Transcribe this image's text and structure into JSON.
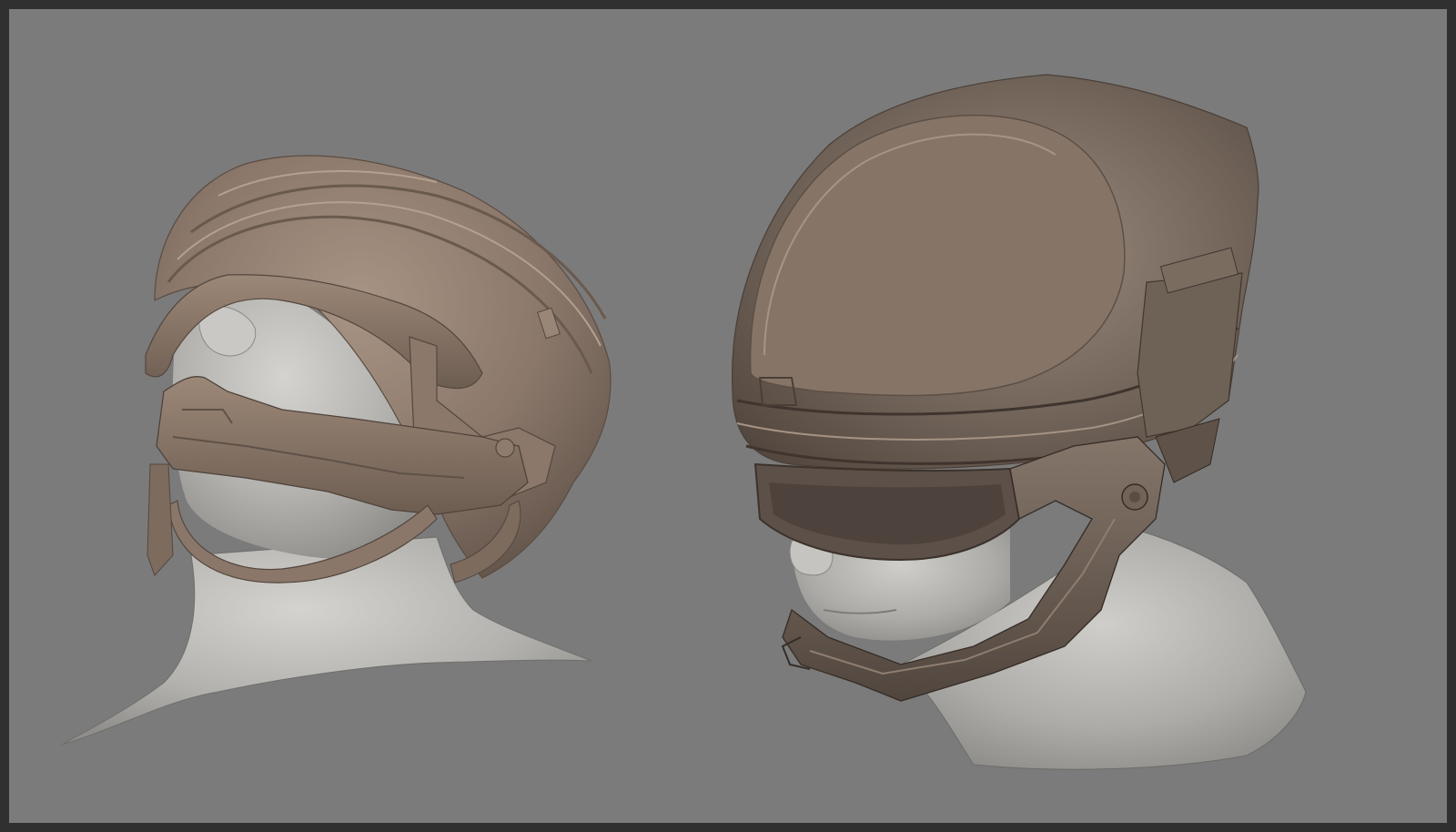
{
  "viewport": {
    "background_color": "#7b7b7b",
    "frame_color": "#303030"
  },
  "models": [
    {
      "name": "helmet-model-left",
      "skin_color": "#b9b8b4",
      "armor_color": "#8d7b6d"
    },
    {
      "name": "helmet-model-right",
      "skin_color": "#b6b5b1",
      "armor_color": "#76685d"
    }
  ]
}
